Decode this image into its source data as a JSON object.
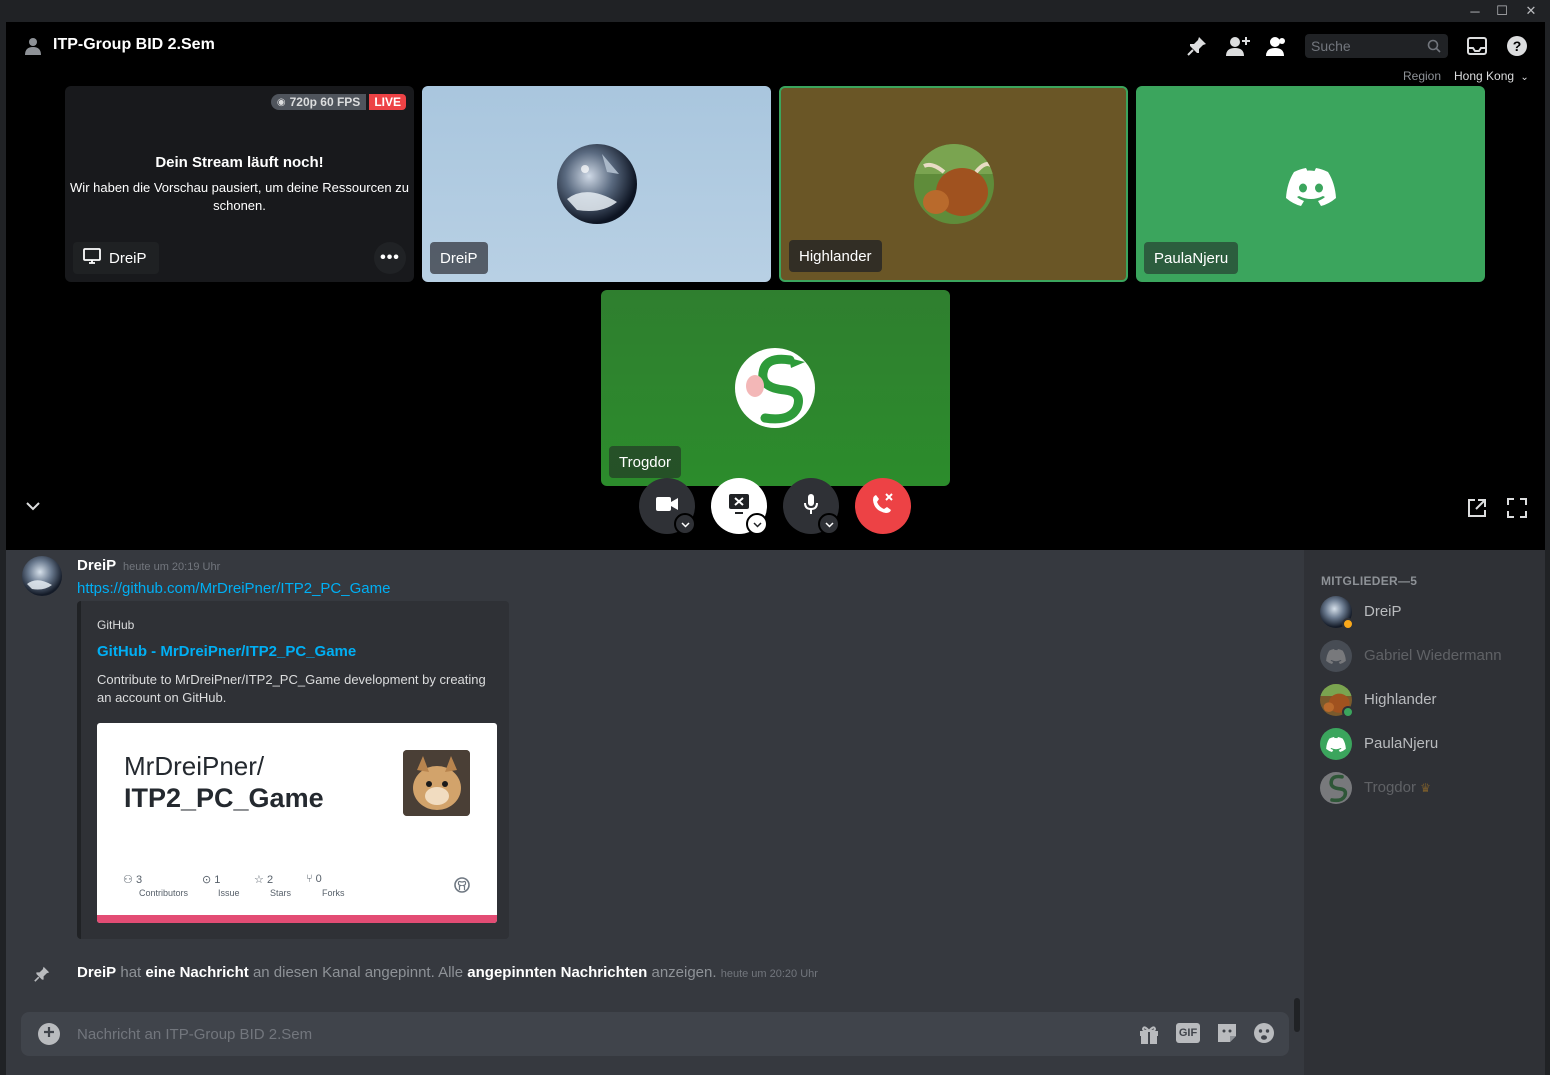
{
  "window": {
    "minimize": "─",
    "maximize": "☐",
    "close": "✕"
  },
  "header": {
    "channel_name": "ITP-Group BID 2.Sem",
    "search_placeholder": "Suche",
    "region_label": "Region",
    "region_value": "Hong Kong"
  },
  "stream": {
    "quality": "720p 60 FPS",
    "live_badge": "LIVE",
    "title": "Dein Stream läuft noch!",
    "message": "Wir haben die Vorschau pausiert, um deine Ressourcen zu schonen.",
    "streamer": "DreiP"
  },
  "participants": [
    {
      "name": "DreiP"
    },
    {
      "name": "Highlander"
    },
    {
      "name": "PaulaNjeru"
    },
    {
      "name": "Trogdor"
    }
  ],
  "message": {
    "author": "DreiP",
    "timestamp": "heute um 20:19 Uhr",
    "link": "https://github.com/MrDreiPner/ITP2_PC_Game",
    "embed": {
      "provider": "GitHub",
      "title": "GitHub - MrDreiPner/ITP2_PC_Game",
      "description": "Contribute to MrDreiPner/ITP2_PC_Game development by creating an account on GitHub.",
      "card_owner": "MrDreiPner/",
      "card_repo": "ITP2_PC_Game",
      "stats": [
        {
          "value": "3",
          "label": "Contributors"
        },
        {
          "value": "1",
          "label": "Issue"
        },
        {
          "value": "2",
          "label": "Stars"
        },
        {
          "value": "0",
          "label": "Forks"
        }
      ]
    }
  },
  "pin_notice": {
    "author": "DreiP",
    "text1": "hat",
    "link1": "eine Nachricht",
    "text2": "an diesen Kanal angepinnt. Alle",
    "link2": "angepinnten Nachrichten",
    "text3": "anzeigen.",
    "timestamp": "heute um 20:20 Uhr"
  },
  "composer": {
    "placeholder": "Nachricht an ITP-Group BID 2.Sem"
  },
  "members": {
    "header": "MITGLIEDER—5",
    "list": [
      {
        "name": "DreiP"
      },
      {
        "name": "Gabriel Wiedermann"
      },
      {
        "name": "Highlander"
      },
      {
        "name": "PaulaNjeru"
      },
      {
        "name": "Trogdor",
        "badge": "♛"
      }
    ]
  },
  "colors": {
    "accent": "#5865f2",
    "green_tile": "#3ba55d",
    "live_red": "#ed4245",
    "link_blue": "#00aff4",
    "online_green": "#3ba55d",
    "idle_yellow": "#faa81a"
  }
}
